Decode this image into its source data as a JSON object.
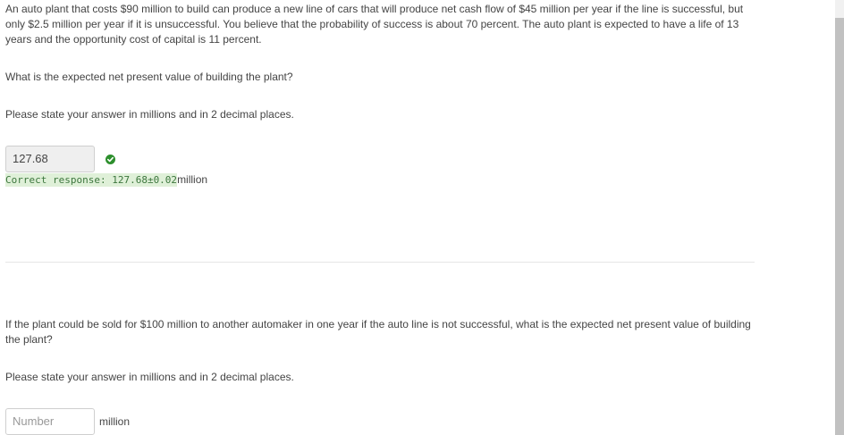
{
  "question1": {
    "intro": "An auto plant that costs $90 million to build can produce a new line of cars that will produce net cash flow of $45 million per year if the line is successful, but only $2.5 million per year if it is unsuccessful. You believe that the probability of success is about 70 percent. The auto plant is expected to have a life of 13 years and the opportunity cost of capital is 11 percent.",
    "question": "What is the expected net present value of building the plant?",
    "instruction": "Please state your answer in millions and in 2 decimal places.",
    "answer_value": "127.68",
    "status_icon": "check-circle-icon",
    "correct_response": "Correct response: 127.68±0.02",
    "correct_unit": "million"
  },
  "question2": {
    "intro": "If the plant could be sold for $100 million to another automaker in one year if the auto line is not successful, what is the expected net present value of building the plant?",
    "instruction": "Please state your answer in millions and in 2 decimal places.",
    "answer_placeholder": "Number",
    "answer_value": "",
    "unit": "million"
  },
  "colors": {
    "text": "#444444",
    "success_green": "#2d8f2d",
    "success_bg": "#dff0d8",
    "success_text": "#3c763d",
    "input_border": "#cfcfcf",
    "scrollbar_thumb": "#c1c1c1"
  }
}
